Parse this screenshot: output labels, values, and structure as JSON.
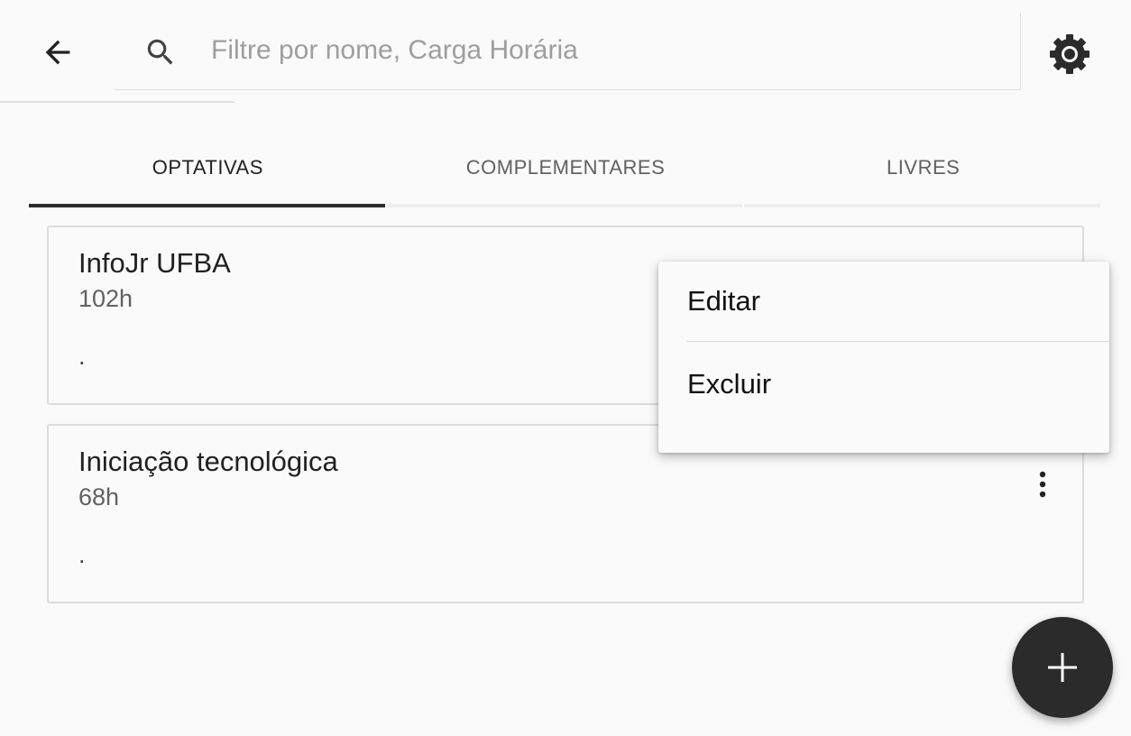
{
  "header": {
    "back_icon": "arrow-left-icon",
    "search": {
      "icon": "search-icon",
      "placeholder": "Filtre por nome, Carga Horária",
      "value": ""
    },
    "settings_icon": "gear-icon"
  },
  "tabs": [
    {
      "label": "OPTATIVAS",
      "active": true
    },
    {
      "label": "COMPLEMENTARES",
      "active": false
    },
    {
      "label": "LIVRES",
      "active": false
    }
  ],
  "cards": [
    {
      "title": "InfoJr UFBA",
      "hours": "102h",
      "description": "."
    },
    {
      "title": "Iniciação tecnológica",
      "hours": "68h",
      "description": ".",
      "menu_icon": "more-vertical-icon"
    }
  ],
  "popup_menu": {
    "items": [
      {
        "label": "Editar"
      },
      {
        "label": "Excluir"
      }
    ]
  },
  "fab": {
    "icon": "plus-icon"
  },
  "colors": {
    "background": "#fafafa",
    "accent": "#2b2b2b",
    "text_primary": "#212121",
    "text_secondary": "#616161",
    "placeholder": "#9e9e9e"
  }
}
